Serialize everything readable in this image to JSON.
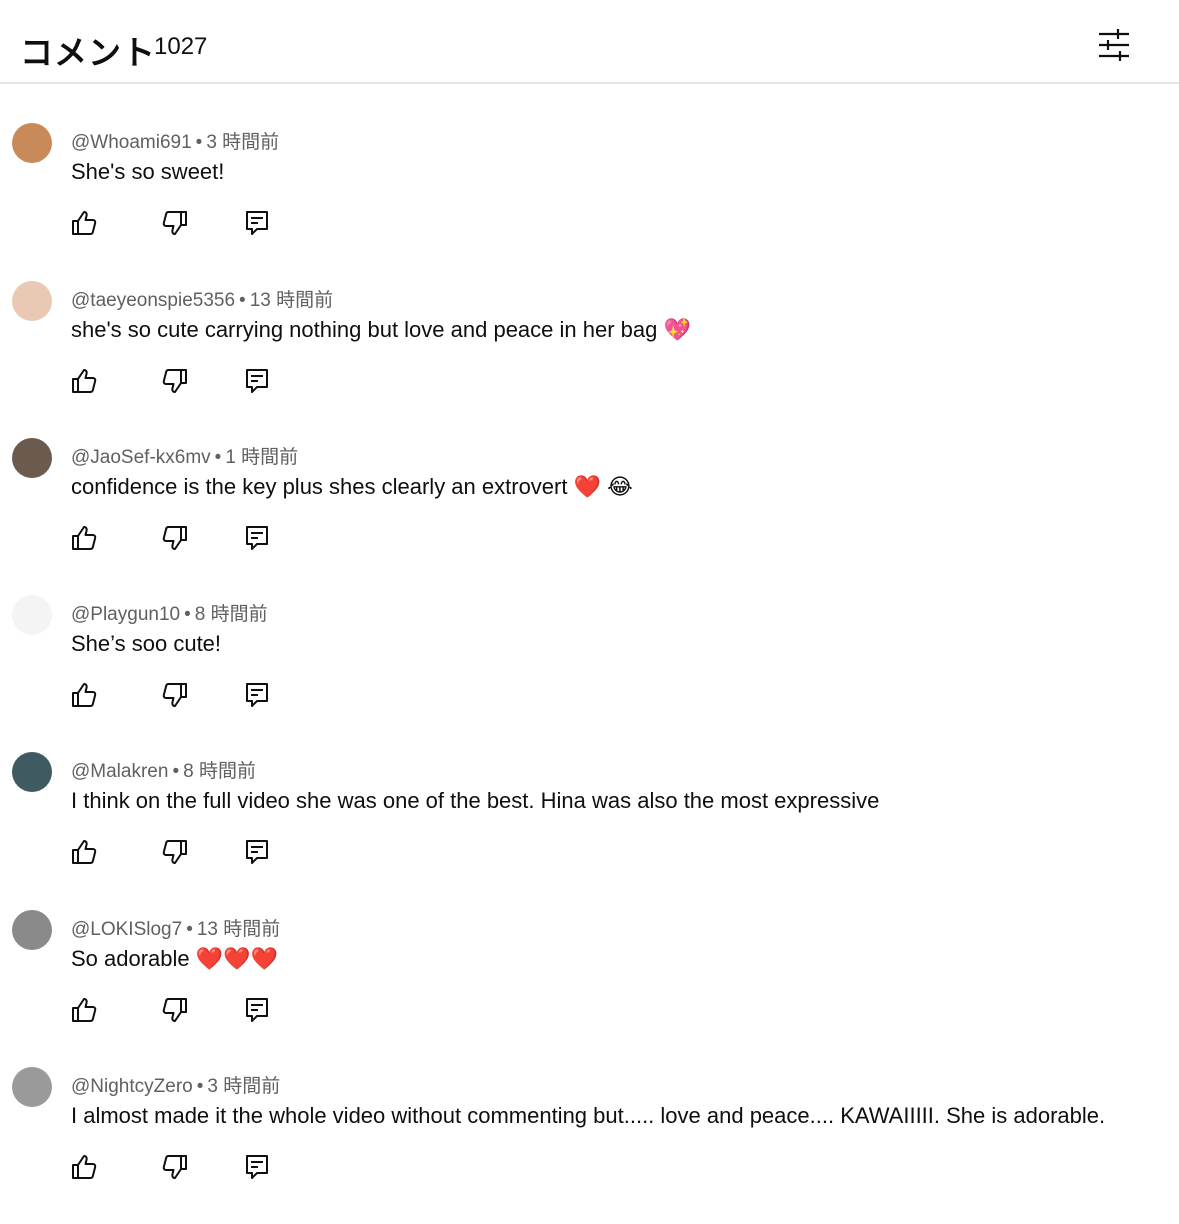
{
  "header": {
    "title": "コメント",
    "count": "1027",
    "filter_icon": "sliders-icon"
  },
  "icons": {
    "like": "thumbs-up-icon",
    "dislike": "thumbs-down-icon",
    "reply": "reply-comment-icon"
  },
  "comments": [
    {
      "author": "@Whoami691",
      "time": "3 時間前",
      "text": "She's so sweet!",
      "avatar_color": "#c98a5a"
    },
    {
      "author": "@taeyeonspie5356",
      "time": "13 時間前",
      "text": "she's so cute carrying nothing but love and peace in her bag 💖",
      "avatar_color": "#e9c9b3"
    },
    {
      "author": "@JaoSef-kx6mv",
      "time": "1 時間前",
      "text": "confidence is the key plus shes clearly an extrovert ❤️ 😂",
      "avatar_color": "#6b5a4e"
    },
    {
      "author": "@Playgun10",
      "time": "8 時間前",
      "text": "She’s soo cute!",
      "avatar_color": "#f4f4f4"
    },
    {
      "author": "@Malakren",
      "time": "8 時間前",
      "text": "I think on the full video she was one of the best. Hina was also the most expressive",
      "avatar_color": "#3f5a60"
    },
    {
      "author": "@LOKISlog7",
      "time": "13 時間前",
      "text": "So adorable ❤️❤️❤️",
      "avatar_color": "#8a8a8a"
    },
    {
      "author": "@NightcyZero",
      "time": "3 時間前",
      "text": "I almost made it the whole video without commenting but.....  love and peace.... KAWAIIIII. She is adorable.",
      "avatar_color": "#9a9a9a"
    }
  ]
}
